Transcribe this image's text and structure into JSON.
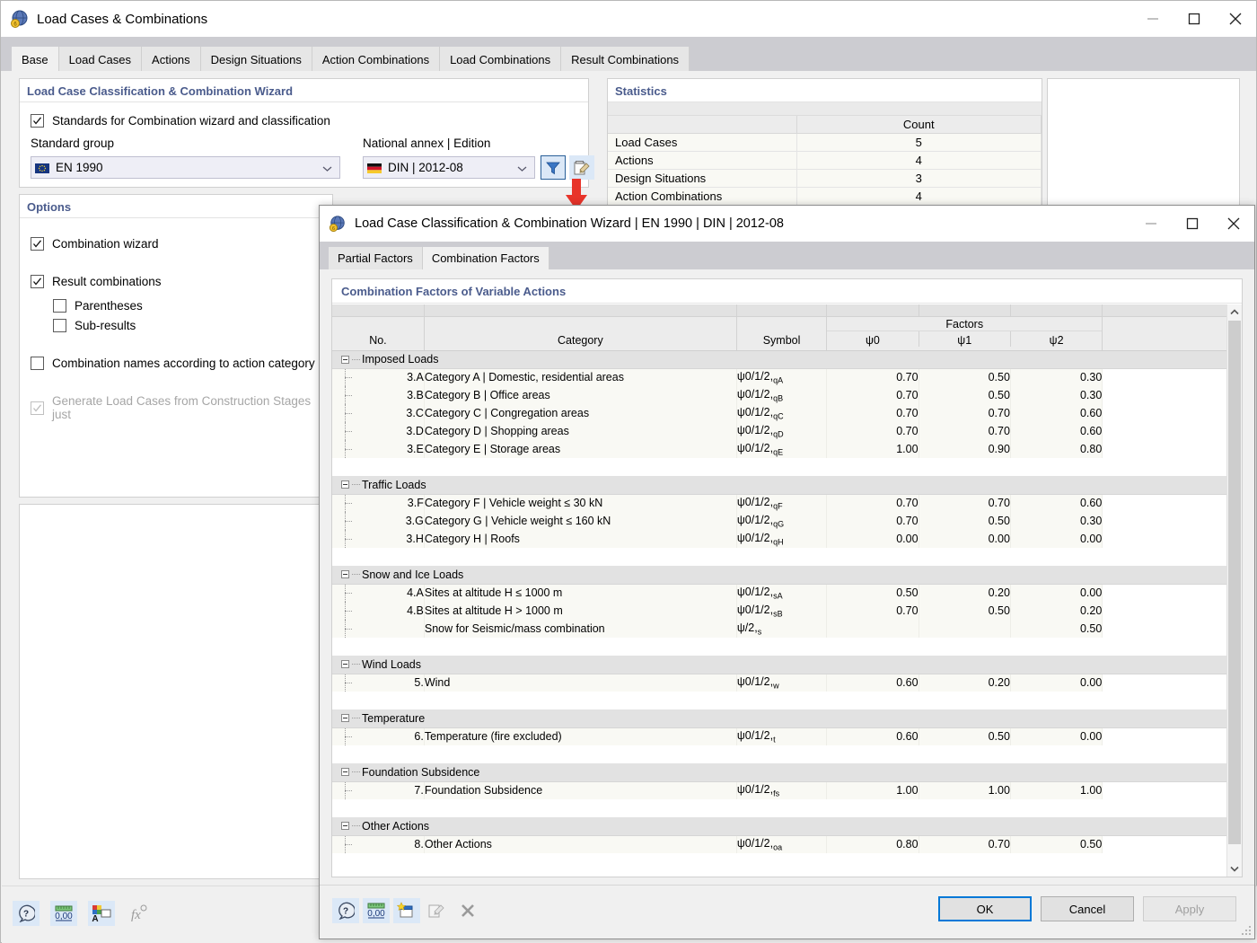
{
  "main_window": {
    "title": "Load Cases & Combinations",
    "app_icon": "load-cases-icon",
    "window_controls": {
      "minimize": "minimize-icon",
      "maximize": "maximize-icon",
      "close": "close-icon"
    },
    "tabs": [
      {
        "label": "Base",
        "active": true
      },
      {
        "label": "Load Cases",
        "active": false
      },
      {
        "label": "Actions",
        "active": false
      },
      {
        "label": "Design Situations",
        "active": false
      },
      {
        "label": "Action Combinations",
        "active": false
      },
      {
        "label": "Load Combinations",
        "active": false
      },
      {
        "label": "Result Combinations",
        "active": false
      }
    ],
    "classification": {
      "heading": "Load Case Classification & Combination Wizard",
      "standards_checkbox": {
        "label": "Standards for Combination wizard and classification",
        "checked": true
      },
      "standard_group_label": "Standard group",
      "standard_group_value": "EN 1990",
      "standard_group_flag": "eu-flag-icon",
      "national_annex_label": "National annex | Edition",
      "national_annex_value": "DIN | 2012-08",
      "national_annex_flag": "german-flag-icon",
      "filter_button": "filter-funnel-icon",
      "edit_button": "edit-standard-icon"
    },
    "options": {
      "heading": "Options",
      "items": [
        {
          "label": "Combination wizard",
          "checked": true,
          "disabled": false,
          "indent": false
        },
        {
          "label": "Result combinations",
          "checked": true,
          "disabled": false,
          "indent": false
        },
        {
          "label": "Parentheses",
          "checked": false,
          "disabled": false,
          "indent": true
        },
        {
          "label": "Sub-results",
          "checked": false,
          "disabled": false,
          "indent": true
        },
        {
          "label": "Combination names according to action category",
          "checked": false,
          "disabled": false,
          "indent": false
        },
        {
          "label": "Generate Load Cases from Construction Stages just",
          "checked": true,
          "disabled": true,
          "indent": false
        }
      ]
    },
    "statistics": {
      "heading": "Statistics",
      "columns": [
        "",
        "Count"
      ],
      "rows": [
        {
          "name": "Load Cases",
          "count": "5"
        },
        {
          "name": "Actions",
          "count": "4"
        },
        {
          "name": "Design Situations",
          "count": "3"
        },
        {
          "name": "Action Combinations",
          "count": "4"
        }
      ]
    },
    "bottom_toolbar": [
      {
        "name": "help-icon",
        "lit": true
      },
      {
        "name": "units-icon",
        "lit": true
      },
      {
        "name": "display-properties-icon",
        "lit": true
      },
      {
        "name": "formula-icon",
        "lit": false
      }
    ],
    "annotation_arrow": "red-down-arrow"
  },
  "dialog": {
    "title": "Load Case Classification & Combination Wizard | EN 1990 | DIN | 2012-08",
    "app_icon": "wizard-icon",
    "window_controls": {
      "minimize": "minimize-icon",
      "maximize": "maximize-icon",
      "close": "close-icon"
    },
    "tabs": [
      {
        "label": "Partial Factors",
        "active": false
      },
      {
        "label": "Combination Factors",
        "active": true
      }
    ],
    "table_heading": "Combination Factors of Variable Actions",
    "columns": {
      "no": "No.",
      "category": "Category",
      "symbol": "Symbol",
      "factors_group": "Factors",
      "psi0": "ψ0",
      "psi1": "ψ1",
      "psi2": "ψ2"
    },
    "groups": [
      {
        "name": "Imposed Loads",
        "rows": [
          {
            "no": "3.A",
            "category": "Category A | Domestic, residential areas",
            "symbol_base": "ψ0/1/2,",
            "symbol_sub": "qA",
            "psi0": "0.70",
            "psi1": "0.50",
            "psi2": "0.30"
          },
          {
            "no": "3.B",
            "category": "Category B | Office areas",
            "symbol_base": "ψ0/1/2,",
            "symbol_sub": "qB",
            "psi0": "0.70",
            "psi1": "0.50",
            "psi2": "0.30"
          },
          {
            "no": "3.C",
            "category": "Category C | Congregation areas",
            "symbol_base": "ψ0/1/2,",
            "symbol_sub": "qC",
            "psi0": "0.70",
            "psi1": "0.70",
            "psi2": "0.60"
          },
          {
            "no": "3.D",
            "category": "Category D | Shopping areas",
            "symbol_base": "ψ0/1/2,",
            "symbol_sub": "qD",
            "psi0": "0.70",
            "psi1": "0.70",
            "psi2": "0.60"
          },
          {
            "no": "3.E",
            "category": "Category E | Storage areas",
            "symbol_base": "ψ0/1/2,",
            "symbol_sub": "qE",
            "psi0": "1.00",
            "psi1": "0.90",
            "psi2": "0.80"
          }
        ]
      },
      {
        "name": "Traffic Loads",
        "rows": [
          {
            "no": "3.F",
            "category": "Category F | Vehicle weight ≤ 30 kN",
            "symbol_base": "ψ0/1/2,",
            "symbol_sub": "qF",
            "psi0": "0.70",
            "psi1": "0.70",
            "psi2": "0.60"
          },
          {
            "no": "3.G",
            "category": "Category G | Vehicle weight ≤ 160 kN",
            "symbol_base": "ψ0/1/2,",
            "symbol_sub": "qG",
            "psi0": "0.70",
            "psi1": "0.50",
            "psi2": "0.30"
          },
          {
            "no": "3.H",
            "category": "Category H | Roofs",
            "symbol_base": "ψ0/1/2,",
            "symbol_sub": "qH",
            "psi0": "0.00",
            "psi1": "0.00",
            "psi2": "0.00"
          }
        ]
      },
      {
        "name": "Snow and Ice Loads",
        "rows": [
          {
            "no": "4.A",
            "category": "Sites at altitude H ≤ 1000 m",
            "symbol_base": "ψ0/1/2,",
            "symbol_sub": "sA",
            "psi0": "0.50",
            "psi1": "0.20",
            "psi2": "0.00"
          },
          {
            "no": "4.B",
            "category": "Sites at altitude H > 1000 m",
            "symbol_base": "ψ0/1/2,",
            "symbol_sub": "sB",
            "psi0": "0.70",
            "psi1": "0.50",
            "psi2": "0.20"
          },
          {
            "no": "",
            "category": "Snow for Seismic/mass combination",
            "symbol_base": "ψ/2,",
            "symbol_sub": "s",
            "psi0": "",
            "psi1": "",
            "psi2": "0.50"
          }
        ]
      },
      {
        "name": "Wind Loads",
        "rows": [
          {
            "no": "5.",
            "category": "Wind",
            "symbol_base": "ψ0/1/2,",
            "symbol_sub": "w",
            "psi0": "0.60",
            "psi1": "0.20",
            "psi2": "0.00"
          }
        ]
      },
      {
        "name": "Temperature",
        "rows": [
          {
            "no": "6.",
            "category": "Temperature (fire excluded)",
            "symbol_base": "ψ0/1/2,",
            "symbol_sub": "t",
            "psi0": "0.60",
            "psi1": "0.50",
            "psi2": "0.00"
          }
        ]
      },
      {
        "name": "Foundation Subsidence",
        "rows": [
          {
            "no": "7.",
            "category": "Foundation Subsidence",
            "symbol_base": "ψ0/1/2,",
            "symbol_sub": "fs",
            "psi0": "1.00",
            "psi1": "1.00",
            "psi2": "1.00"
          }
        ]
      },
      {
        "name": "Other Actions",
        "rows": [
          {
            "no": "8.",
            "category": "Other Actions",
            "symbol_base": "ψ0/1/2,",
            "symbol_sub": "oa",
            "psi0": "0.80",
            "psi1": "0.70",
            "psi2": "0.50"
          }
        ]
      }
    ],
    "footer_toolbar": [
      {
        "name": "help-icon",
        "lit": true
      },
      {
        "name": "units-icon",
        "lit": true
      },
      {
        "name": "new-icon",
        "lit": true
      },
      {
        "name": "edit-icon",
        "lit": false
      },
      {
        "name": "delete-x-icon",
        "lit": false
      }
    ],
    "buttons": {
      "ok": "OK",
      "cancel": "Cancel",
      "apply": "Apply"
    }
  },
  "colors": {
    "heading_blue": "#4a5b8c",
    "accent_blue": "#0078d7",
    "icon_bg": "#dbe8f7",
    "group_row": "#e2e2e2",
    "data_row": "#f9f9f4",
    "arrow_red": "#e8342a"
  }
}
